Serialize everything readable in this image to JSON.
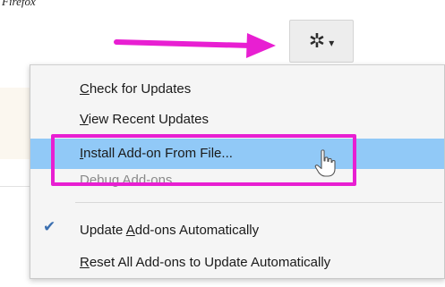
{
  "top": {
    "text": "Firefox"
  },
  "gear_button": {
    "icon": "gear-icon",
    "caret": "chevron-down-icon",
    "gear_glyph": "✲",
    "caret_glyph": "▾"
  },
  "menu": {
    "check_updates": {
      "label": "Check for Updates",
      "underline": "C"
    },
    "view_recent": {
      "label": "View Recent Updates",
      "underline": "V"
    },
    "install_file": {
      "label": "Install Add-on From File...",
      "underline": "I"
    },
    "debug": {
      "label": "Debug Add-ons"
    },
    "update_auto": {
      "label": "Update Add-ons Automatically",
      "pre": "Update ",
      "underline": "A",
      "post": "dd-ons Automatically",
      "checked": true
    },
    "reset_all": {
      "label": "Reset All Add-ons to Update Automatically",
      "underline": "R"
    }
  },
  "colors": {
    "highlight": "#91c9f7",
    "annotation": "#e81fd2",
    "menu_bg": "#f5f5f5",
    "check": "#3b6fb0"
  },
  "check_glyph": "✔"
}
